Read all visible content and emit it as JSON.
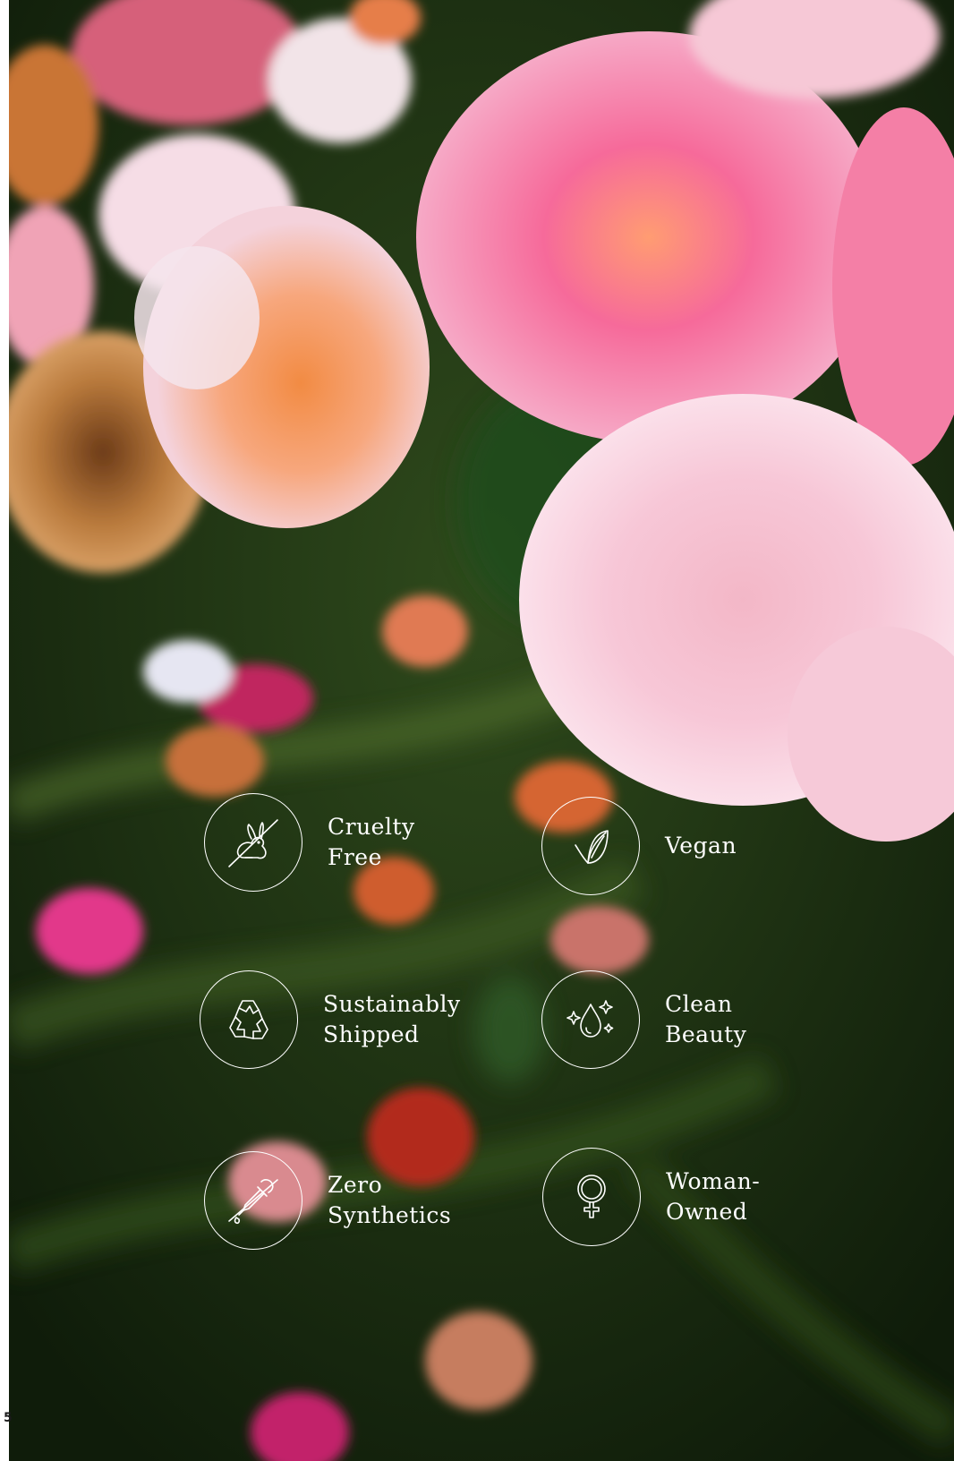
{
  "page_number": "5",
  "colors": {
    "background_green": "#1d3312",
    "rose_pink": "#f26a9e",
    "rose_peach": "#f9a070",
    "icon_white": "#ffffff"
  },
  "badges": [
    {
      "icon": "rabbit-crossed-icon",
      "label": "Cruelty\nFree"
    },
    {
      "icon": "leaf-icon",
      "label": "Vegan"
    },
    {
      "icon": "recycle-icon",
      "label": "Sustainably\nShipped"
    },
    {
      "icon": "water-drop-sparkle-icon",
      "label": "Clean\nBeauty"
    },
    {
      "icon": "dropper-crossed-icon",
      "label": "Zero\nSynthetics"
    },
    {
      "icon": "female-symbol-icon",
      "label": "Woman-\nOwned"
    }
  ]
}
